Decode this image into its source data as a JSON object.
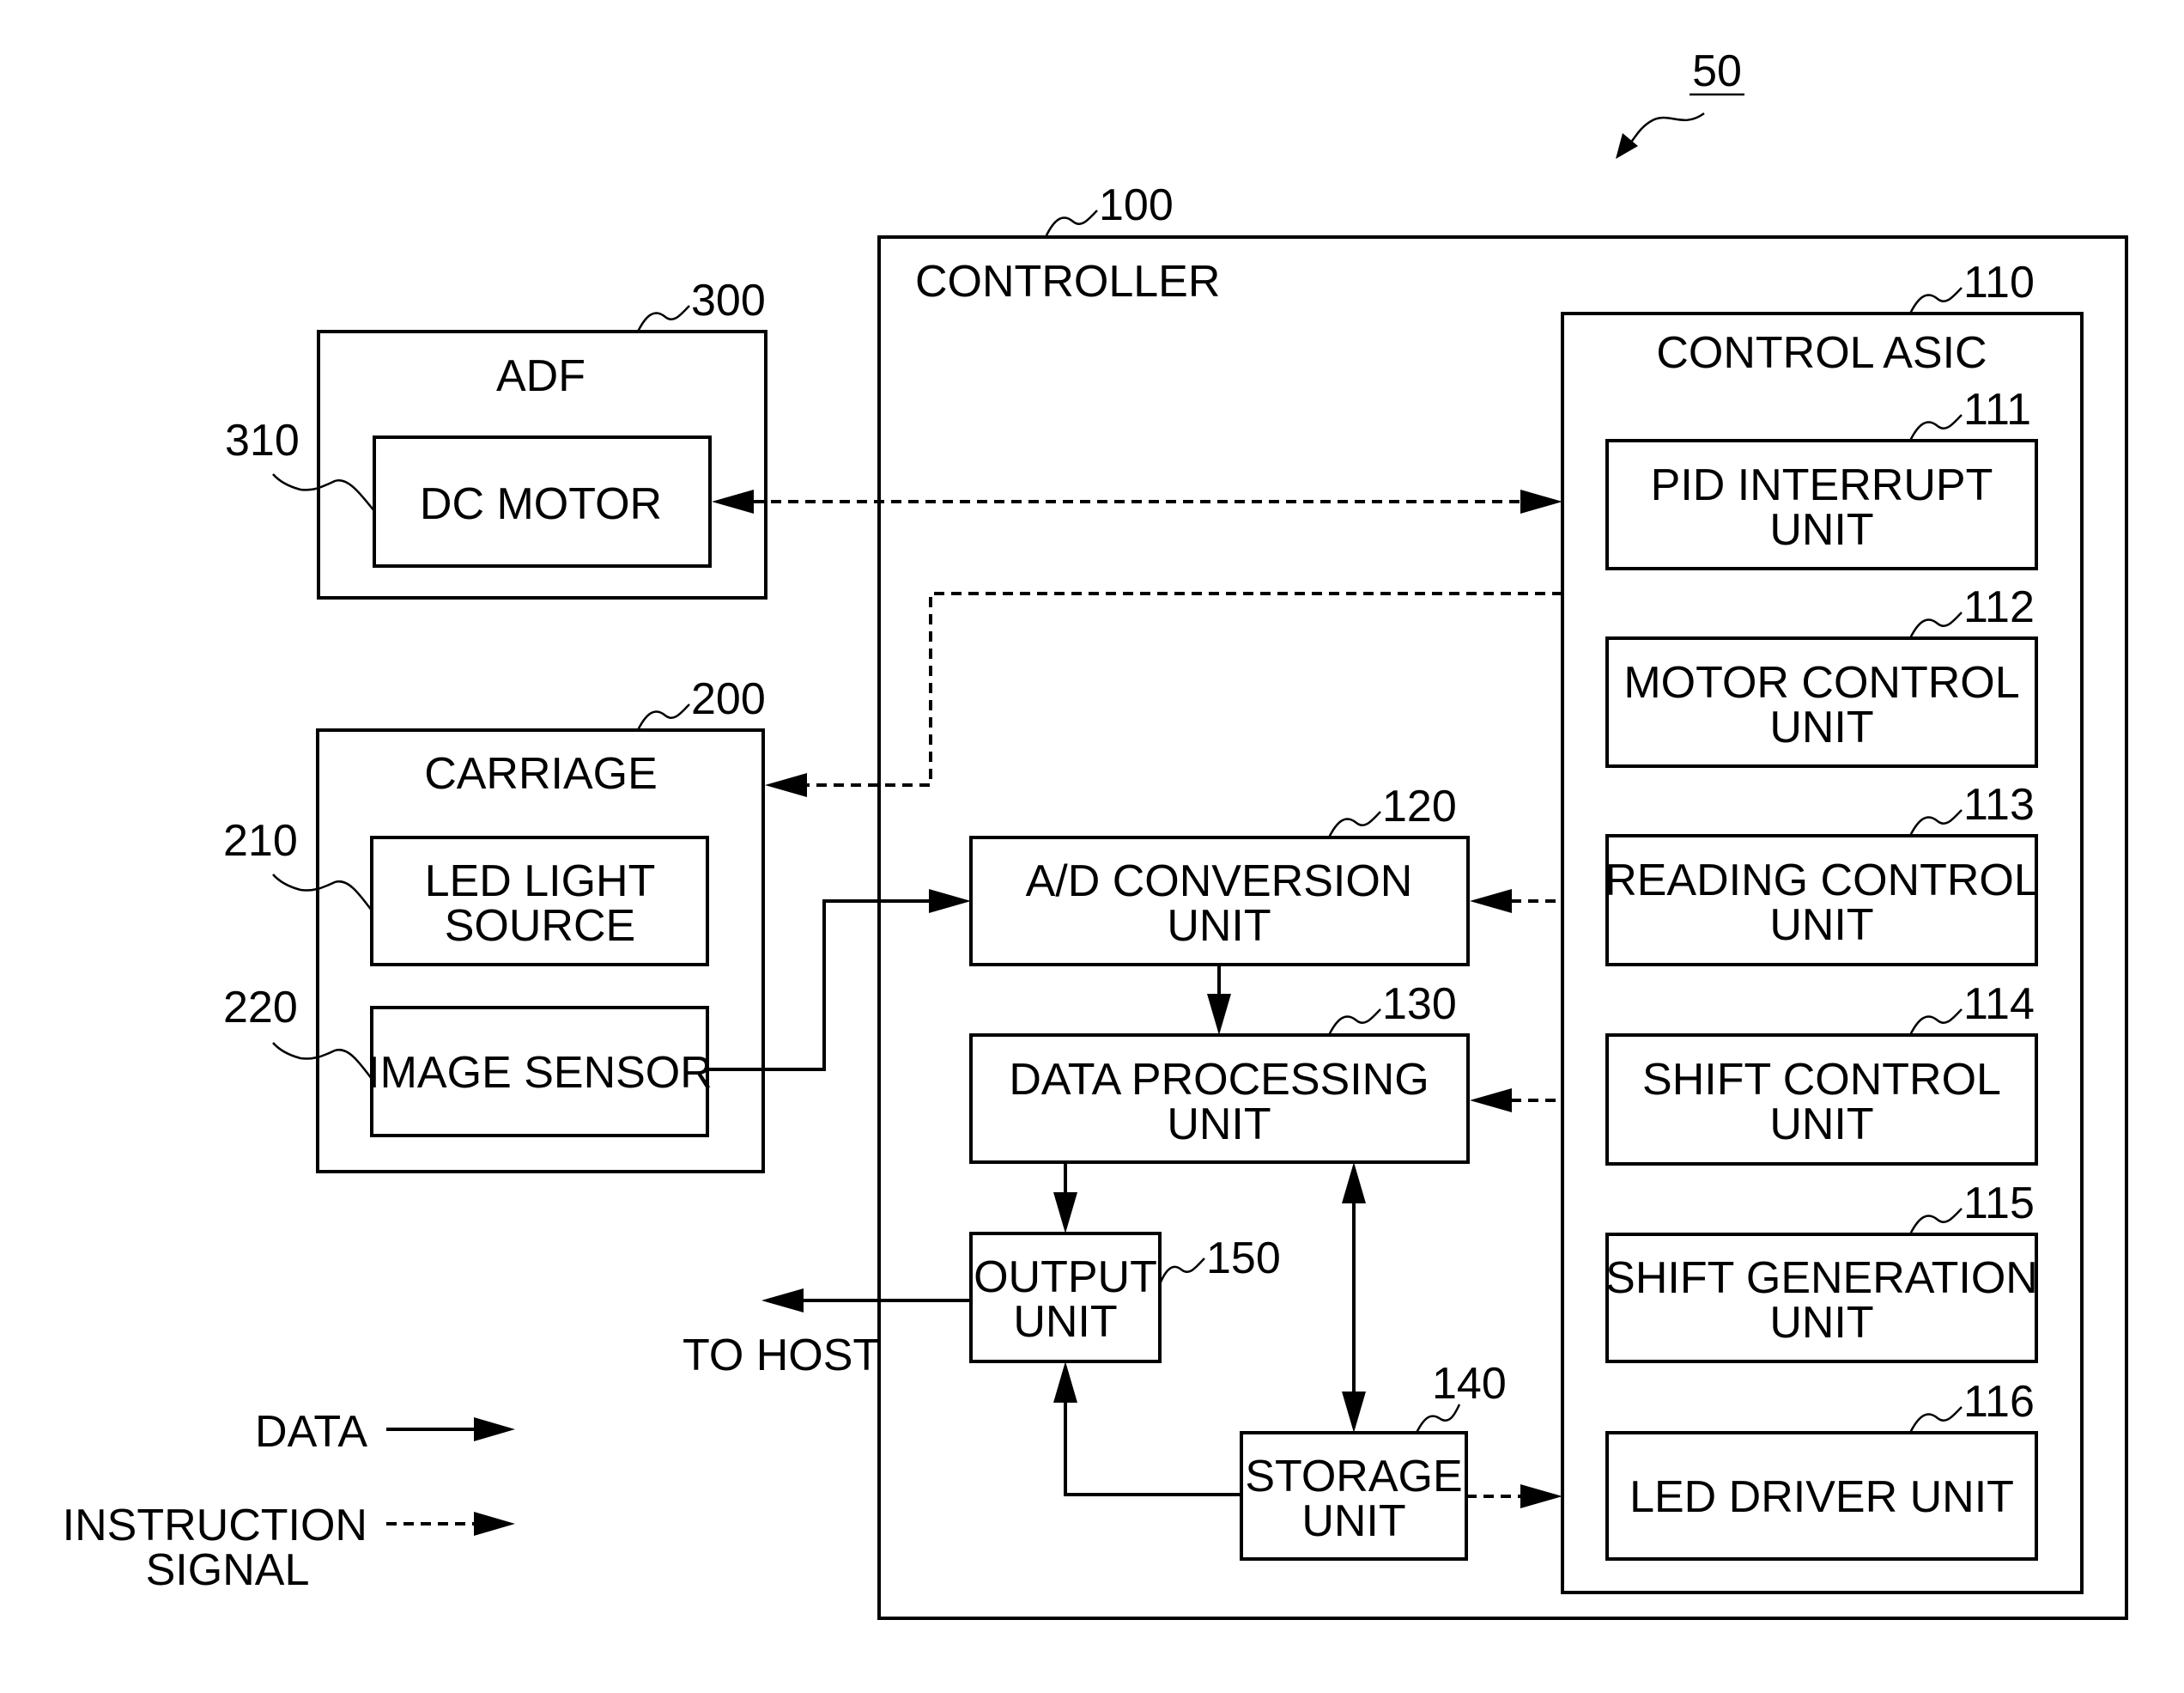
{
  "figure": {
    "ref": "50"
  },
  "controller": {
    "ref": "100",
    "title": "CONTROLLER",
    "asic": {
      "ref": "110",
      "title": "CONTROL ASIC",
      "units": [
        {
          "ref": "111",
          "line1": "PID INTERRUPT",
          "line2": "UNIT"
        },
        {
          "ref": "112",
          "line1": "MOTOR CONTROL",
          "line2": "UNIT"
        },
        {
          "ref": "113",
          "line1": "READING CONTROL",
          "line2": "UNIT"
        },
        {
          "ref": "114",
          "line1": "SHIFT CONTROL",
          "line2": "UNIT"
        },
        {
          "ref": "115",
          "line1": "SHIFT GENERATION",
          "line2": "UNIT"
        },
        {
          "ref": "116",
          "line1": "LED DRIVER UNIT",
          "line2": ""
        }
      ]
    },
    "ad": {
      "ref": "120",
      "line1": "A/D CONVERSION",
      "line2": "UNIT"
    },
    "dp": {
      "ref": "130",
      "line1": "DATA PROCESSING",
      "line2": "UNIT"
    },
    "storage": {
      "ref": "140",
      "line1": "STORAGE",
      "line2": "UNIT"
    },
    "output": {
      "ref": "150",
      "line1": "OUTPUT",
      "line2": "UNIT"
    },
    "to_host": "TO HOST"
  },
  "adf": {
    "ref": "300",
    "title": "ADF",
    "motor": {
      "ref": "310",
      "label": "DC MOTOR"
    }
  },
  "carriage": {
    "ref": "200",
    "title": "CARRIAGE",
    "led": {
      "ref": "210",
      "line1": "LED LIGHT",
      "line2": "SOURCE"
    },
    "sensor": {
      "ref": "220",
      "label": "IMAGE SENSOR"
    }
  },
  "legend": {
    "data": "DATA",
    "instruction_line1": "INSTRUCTION",
    "instruction_line2": "SIGNAL"
  }
}
